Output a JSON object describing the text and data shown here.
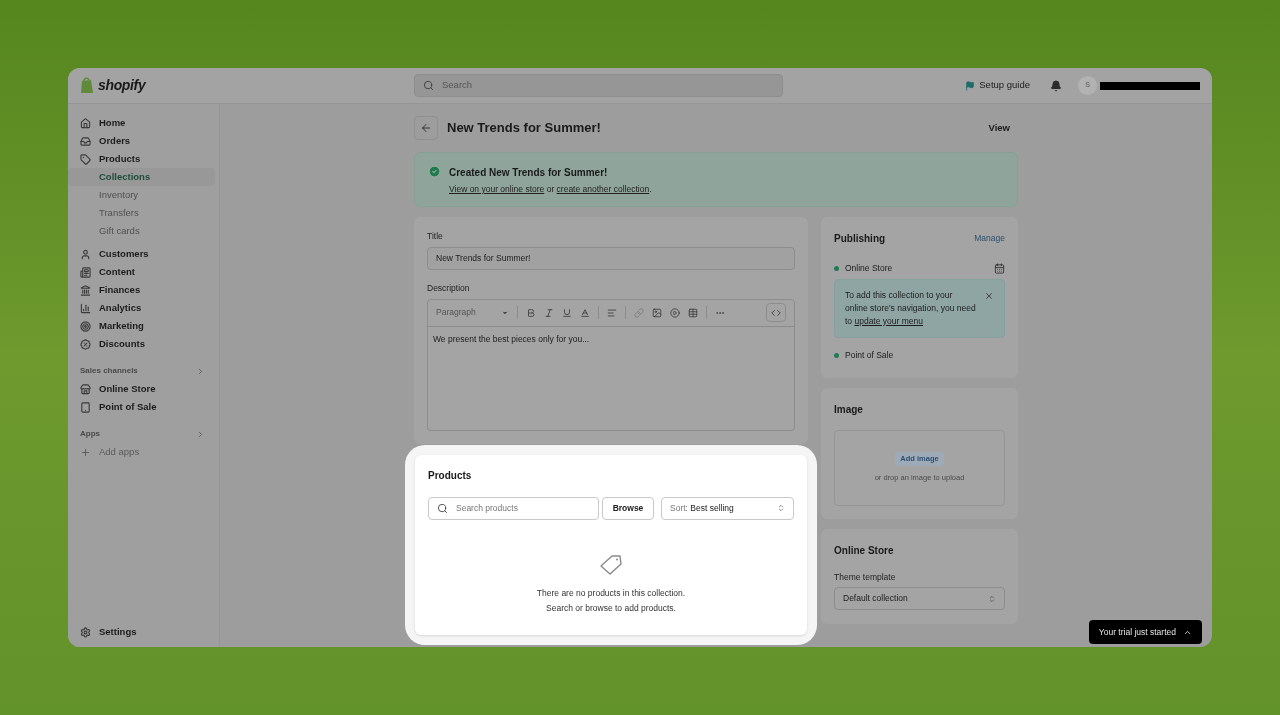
{
  "topbar": {
    "logo": "shopify",
    "search": {
      "placeholder": "Search"
    },
    "setup_guide": "Setup guide",
    "avatar": "S"
  },
  "sidebar": {
    "items": [
      {
        "label": "Home",
        "selected": false
      },
      {
        "label": "Orders",
        "selected": false
      },
      {
        "label": "Products",
        "selected": false,
        "children": [
          {
            "label": "Collections",
            "selected": true
          },
          {
            "label": "Inventory",
            "selected": false
          },
          {
            "label": "Transfers",
            "selected": false
          },
          {
            "label": "Gift cards",
            "selected": false
          }
        ]
      },
      {
        "label": "Customers",
        "selected": false
      },
      {
        "label": "Content",
        "selected": false
      },
      {
        "label": "Finances",
        "selected": false
      },
      {
        "label": "Analytics",
        "selected": false
      },
      {
        "label": "Marketing",
        "selected": false
      },
      {
        "label": "Discounts",
        "selected": false
      }
    ],
    "sections": [
      {
        "title": "Sales channels",
        "items": [
          {
            "label": "Online Store",
            "selected": false
          },
          {
            "label": "Point of Sale",
            "selected": false
          }
        ]
      },
      {
        "title": "Apps",
        "items": [
          {
            "label": "Add apps",
            "kind": "add",
            "selected": false
          }
        ]
      }
    ],
    "settings": "Settings"
  },
  "page": {
    "title": "New Trends for Summer!",
    "action": "View"
  },
  "banner": {
    "title": "Created New Trends for Summer!",
    "link_1": "View on your online store",
    "joiner": " or ",
    "link_2": "create another collection",
    "end": "."
  },
  "details": {
    "title_label": "Title",
    "title_value": "New Trends for Summer!",
    "description_label": "Description",
    "format": "Paragraph",
    "description": "We present the best pieces only for you..."
  },
  "products": {
    "heading": "Products",
    "search_placeholder": "Search products",
    "browse": "Browse",
    "sort_label": "Sort:",
    "sort_value": "Best selling",
    "empty_line_1": "There are no products in this collection.",
    "empty_line_2": "Search or browse to add products."
  },
  "publishing": {
    "heading": "Publishing",
    "manage": "Manage",
    "channels": [
      {
        "name": "Online Store",
        "color": "#237a55"
      },
      {
        "name": "Point of Sale",
        "color": "#237a55"
      }
    ],
    "notice": "To add this collection to your online store's navigation, you need to ",
    "notice_link": "update your menu"
  },
  "image": {
    "heading": "Image",
    "add": "Add image",
    "hint": "or drop an image to upload"
  },
  "online_store": {
    "heading": "Online Store",
    "label": "Theme template",
    "value": "Default collection"
  },
  "toast": "Your trial just started"
}
